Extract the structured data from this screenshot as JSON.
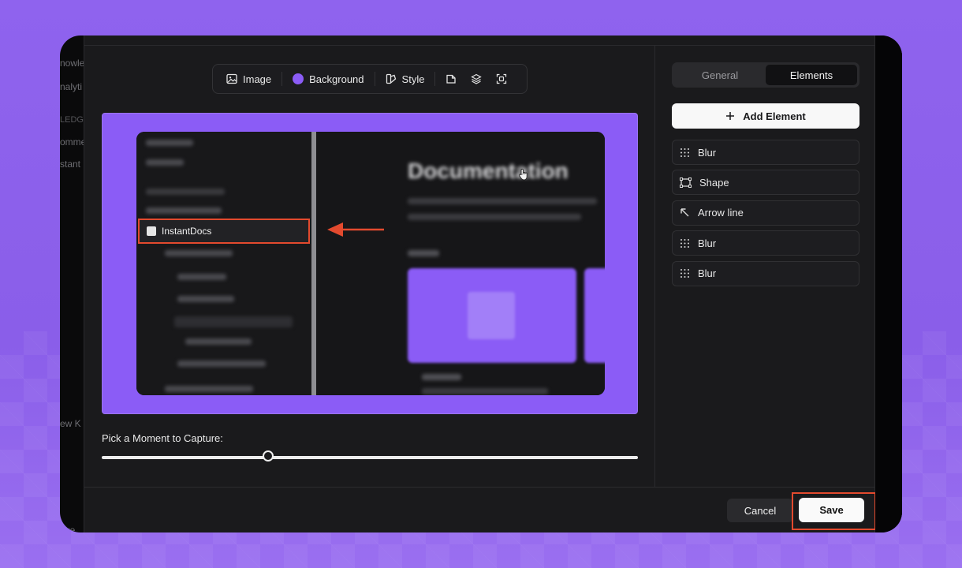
{
  "background_behind": {
    "lines": [
      "nowle",
      "nalyti",
      "LEDG",
      "omme",
      "stant",
      "ew K",
      "Cre"
    ]
  },
  "toolbar": {
    "image_label": "Image",
    "background_label": "Background",
    "style_label": "Style"
  },
  "preview": {
    "highlighted_item": "InstantDocs",
    "doc_title": "Documentation"
  },
  "capture": {
    "label": "Pick a Moment to Capture:",
    "position": 0.31
  },
  "panel": {
    "tabs": [
      {
        "label": "General",
        "active": false
      },
      {
        "label": "Elements",
        "active": true
      }
    ],
    "add_element_label": "Add Element",
    "elements": [
      {
        "label": "Blur",
        "icon": "blur-grid-icon"
      },
      {
        "label": "Shape",
        "icon": "shape-icon"
      },
      {
        "label": "Arrow line",
        "icon": "arrow-line-icon"
      },
      {
        "label": "Blur",
        "icon": "blur-grid-icon"
      },
      {
        "label": "Blur",
        "icon": "blur-grid-icon"
      }
    ]
  },
  "footer": {
    "cancel_label": "Cancel",
    "save_label": "Save"
  },
  "colors": {
    "accent": "#8b5cf6",
    "highlight": "#e34a2e"
  }
}
